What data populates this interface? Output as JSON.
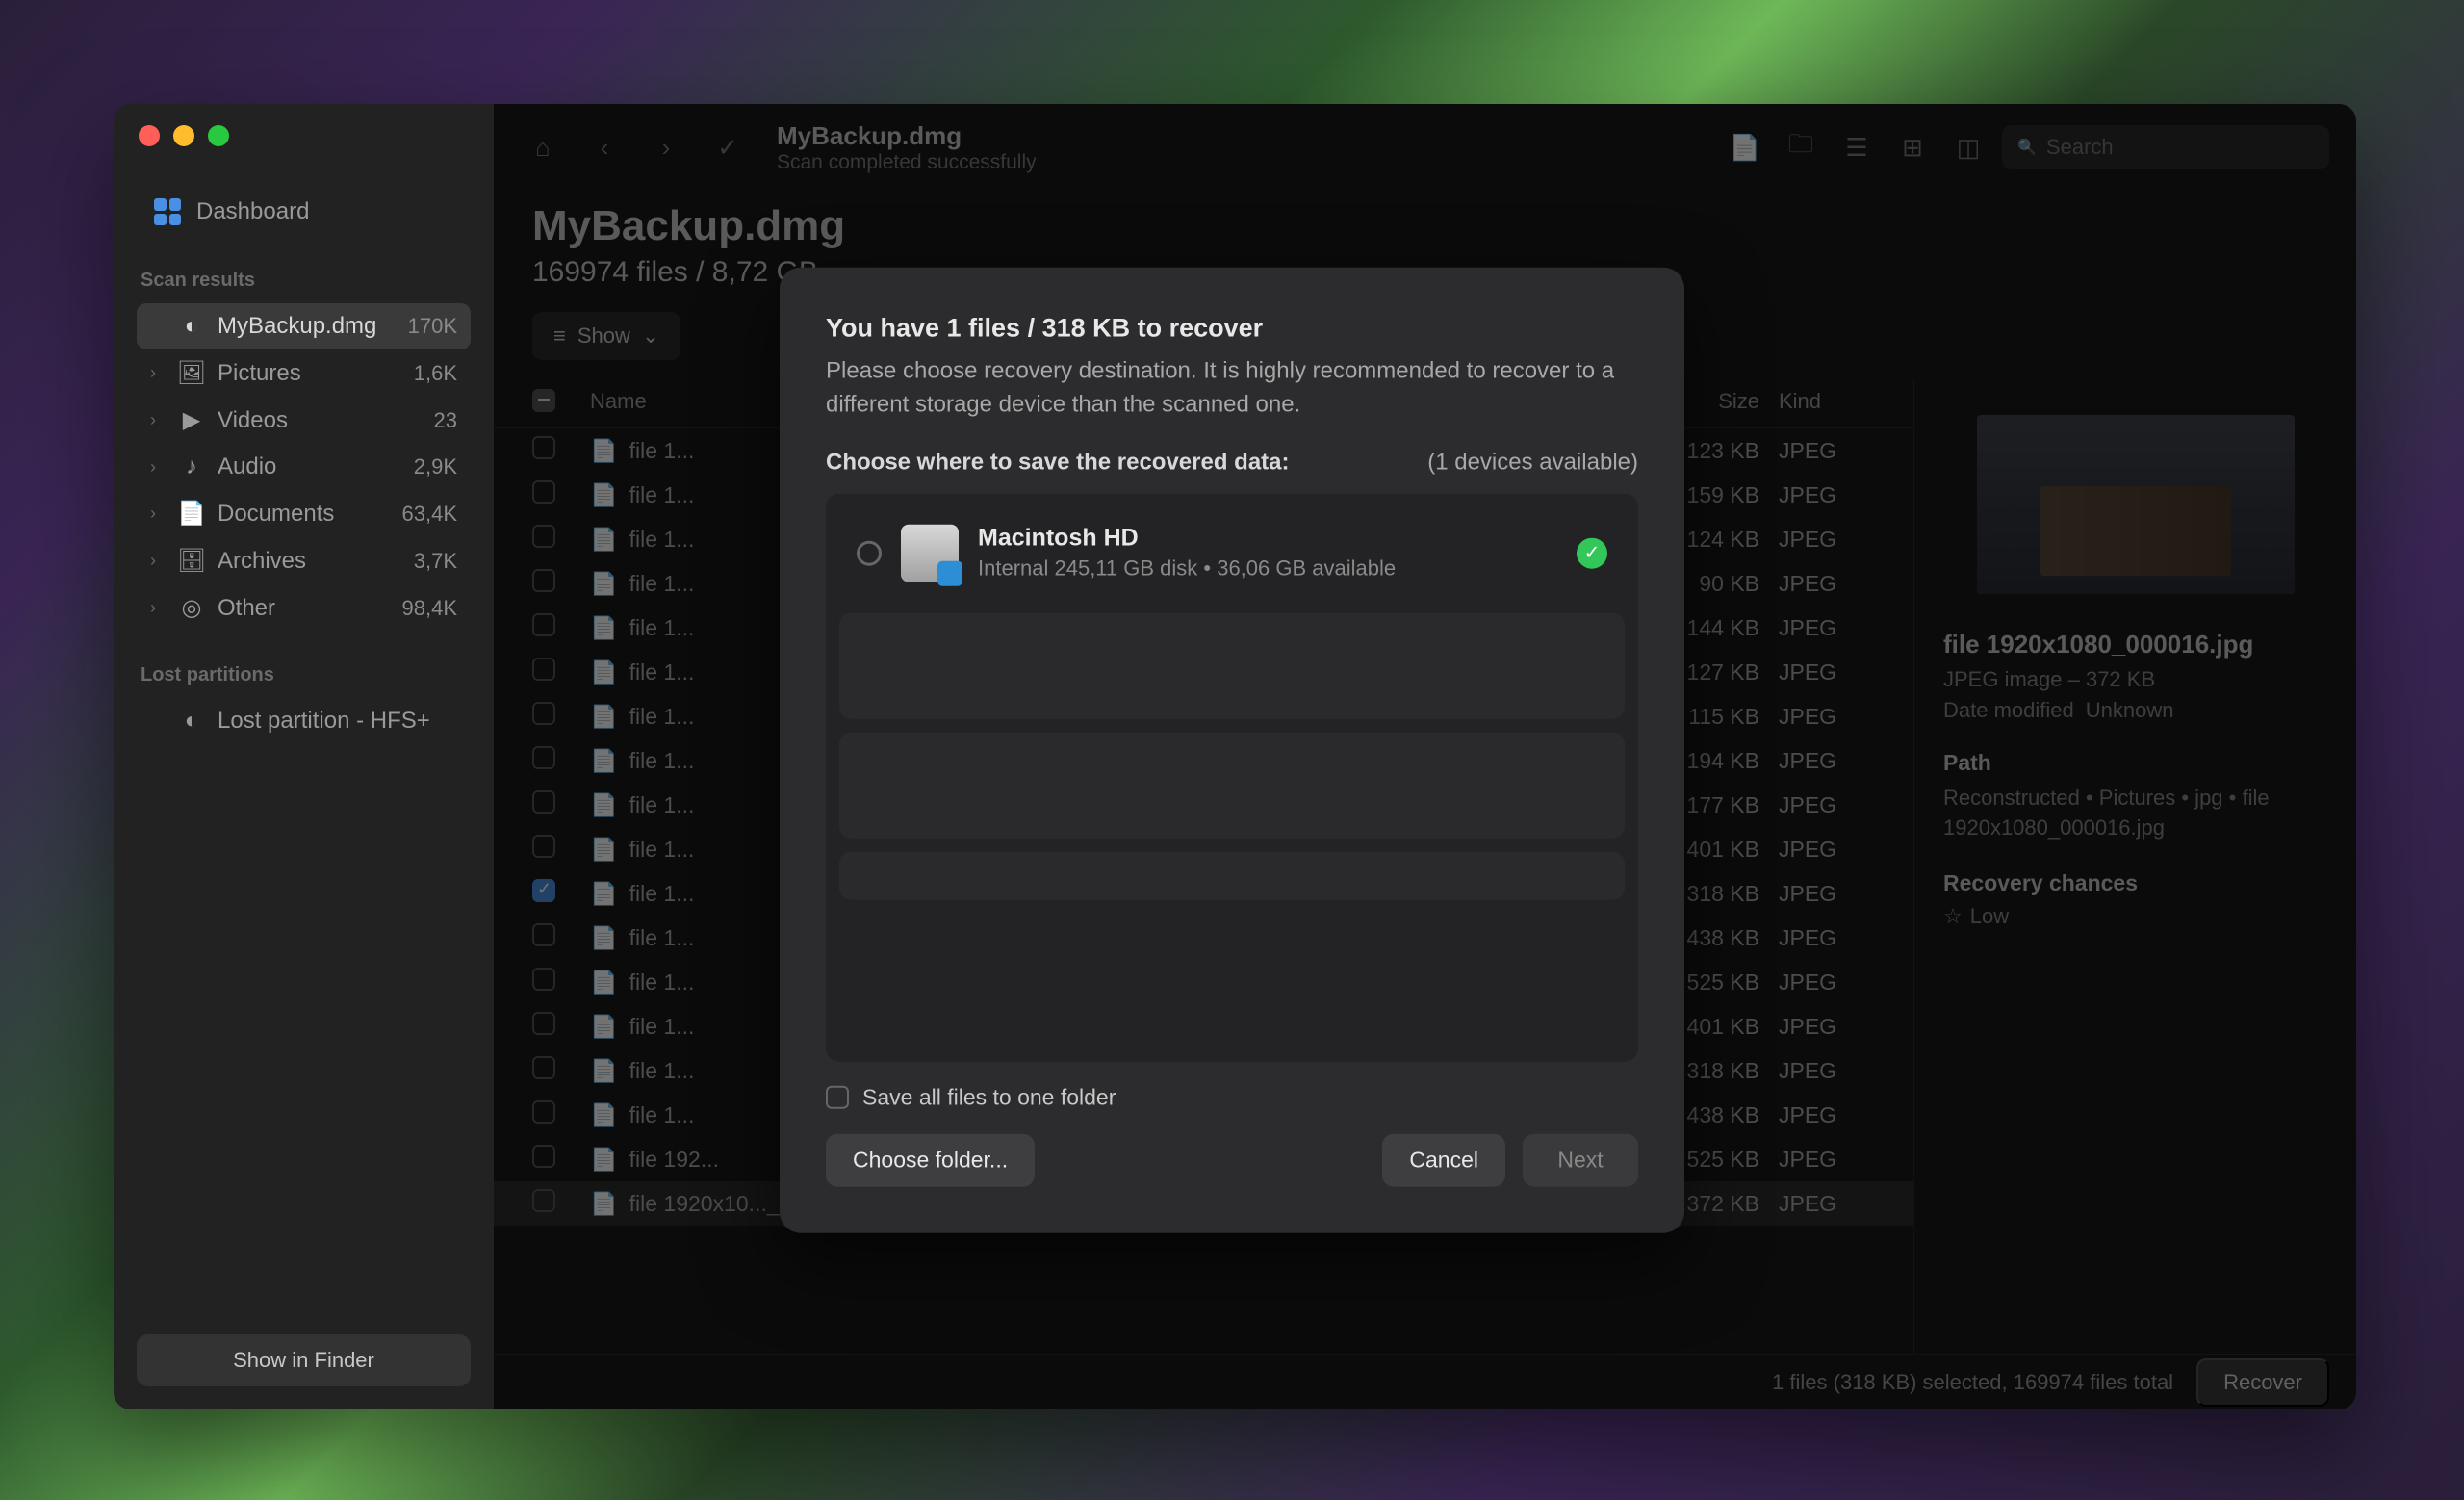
{
  "sidebar": {
    "dashboard": "Dashboard",
    "scanResultsHeader": "Scan results",
    "items": [
      {
        "label": "MyBackup.dmg",
        "count": "170K",
        "icon": "drive",
        "active": true,
        "chev": ""
      },
      {
        "label": "Pictures",
        "count": "1,6K",
        "icon": "image",
        "chev": "›"
      },
      {
        "label": "Videos",
        "count": "23",
        "icon": "video",
        "chev": "›"
      },
      {
        "label": "Audio",
        "count": "2,9K",
        "icon": "audio",
        "chev": "›"
      },
      {
        "label": "Documents",
        "count": "63,4K",
        "icon": "doc",
        "chev": "›"
      },
      {
        "label": "Archives",
        "count": "3,7K",
        "icon": "archive",
        "chev": "›"
      },
      {
        "label": "Other",
        "count": "98,4K",
        "icon": "other",
        "chev": "›"
      }
    ],
    "lostHeader": "Lost partitions",
    "lostItem": "Lost partition - HFS+",
    "showInFinder": "Show in Finder"
  },
  "toolbar": {
    "title": "MyBackup.dmg",
    "subtitle": "Scan completed successfully",
    "searchPlaceholder": "Search"
  },
  "content": {
    "title": "MyBackup.dmg",
    "subtitle": "169974 files / 8,72 GB",
    "showButton": "Show"
  },
  "table": {
    "colName": "Name",
    "colSize": "Size",
    "colKind": "Kind",
    "rows": [
      {
        "name": "file 1...",
        "size": "123 KB",
        "kind": "JPEG",
        "checked": false
      },
      {
        "name": "file 1...",
        "size": "159 KB",
        "kind": "JPEG",
        "checked": false
      },
      {
        "name": "file 1...",
        "size": "124 KB",
        "kind": "JPEG",
        "checked": false
      },
      {
        "name": "file 1...",
        "size": "90 KB",
        "kind": "JPEG",
        "checked": false
      },
      {
        "name": "file 1...",
        "size": "144 KB",
        "kind": "JPEG",
        "checked": false
      },
      {
        "name": "file 1...",
        "size": "127 KB",
        "kind": "JPEG",
        "checked": false
      },
      {
        "name": "file 1...",
        "size": "115 KB",
        "kind": "JPEG",
        "checked": false
      },
      {
        "name": "file 1...",
        "size": "194 KB",
        "kind": "JPEG",
        "checked": false
      },
      {
        "name": "file 1...",
        "size": "177 KB",
        "kind": "JPEG",
        "checked": false
      },
      {
        "name": "file 1...",
        "size": "401 KB",
        "kind": "JPEG",
        "checked": false
      },
      {
        "name": "file 1...",
        "size": "318 KB",
        "kind": "JPEG",
        "checked": true
      },
      {
        "name": "file 1...",
        "size": "438 KB",
        "kind": "JPEG",
        "checked": false
      },
      {
        "name": "file 1...",
        "size": "525 KB",
        "kind": "JPEG",
        "checked": false
      },
      {
        "name": "file 1...",
        "size": "401 KB",
        "kind": "JPEG",
        "checked": false
      },
      {
        "name": "file 1...",
        "size": "318 KB",
        "kind": "JPEG",
        "checked": false
      },
      {
        "name": "file 1...",
        "size": "438 KB",
        "kind": "JPEG",
        "checked": false
      },
      {
        "name": "file 192...",
        "size": "525 KB",
        "kind": "JPEG",
        "checked": false
      },
      {
        "name": "file 1920x10..._000016.jpg",
        "size": "372 KB",
        "kind": "JPEG",
        "checked": false,
        "selected": true,
        "chance": "Low",
        "date": "—"
      }
    ]
  },
  "detail": {
    "filename": "file 1920x1080_000016.jpg",
    "typeSize": "JPEG image – 372 KB",
    "dateLabel": "Date modified",
    "dateValue": "Unknown",
    "pathLabel": "Path",
    "pathValue": "Reconstructed • Pictures • jpg • file 1920x1080_000016.jpg",
    "chancesLabel": "Recovery chances",
    "chancesValue": "Low"
  },
  "statusbar": {
    "text": "1 files (318 KB) selected, 169974 files total",
    "recover": "Recover"
  },
  "modal": {
    "title": "You have 1 files / 318 KB to recover",
    "desc": "Please choose recovery destination. It is highly recommended to recover to a different storage device than the scanned one.",
    "chooseLabel": "Choose where to save the recovered data:",
    "devicesAvail": "(1 devices available)",
    "dest": {
      "name": "Macintosh HD",
      "detail": "Internal 245,11 GB disk • 36,06 GB available"
    },
    "saveAll": "Save all files to one folder",
    "chooseFolder": "Choose folder...",
    "cancel": "Cancel",
    "next": "Next"
  }
}
